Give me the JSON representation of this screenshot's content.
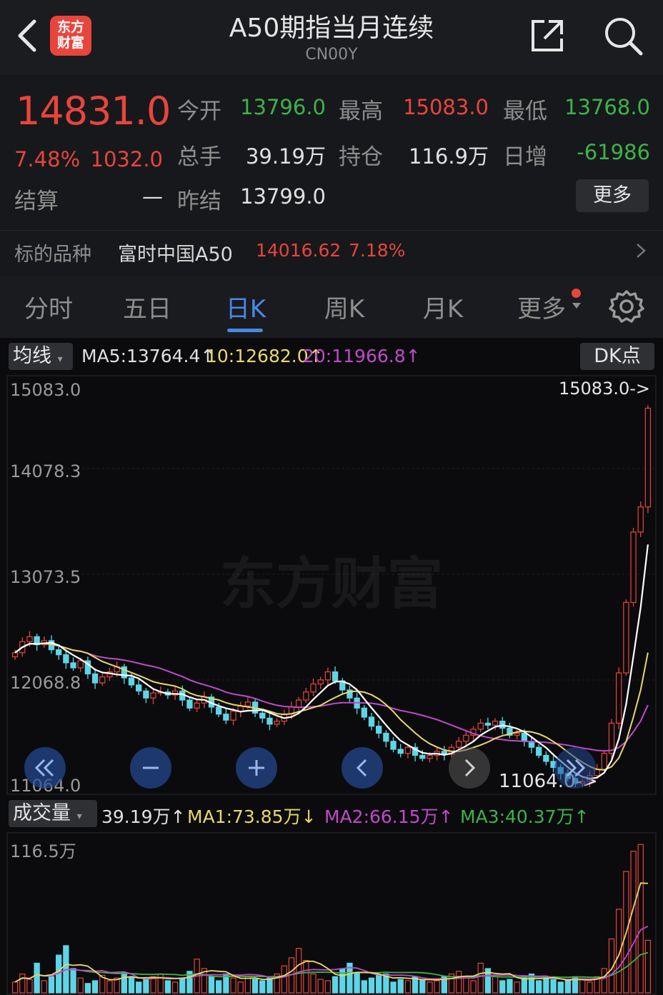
{
  "header": {
    "logo_line1": "东方",
    "logo_line2": "财富",
    "title": "A50期指当月连续",
    "code": "CN00Y"
  },
  "quote": {
    "price": "14831.0",
    "change_pct": "7.48%",
    "change_amt": "1032.0",
    "settle_label": "结算",
    "settle_value": "—",
    "open_label": "今开",
    "open_value": "13796.0",
    "high_label": "最高",
    "high_value": "15083.0",
    "low_label": "最低",
    "low_value": "13768.0",
    "volume_label": "总手",
    "volume_value": "39.19万",
    "oi_label": "持仓",
    "oi_value": "116.9万",
    "daily_inc_label": "日增",
    "daily_inc_value": "-61986",
    "prev_settle_label": "昨结",
    "prev_settle_value": "13799.0",
    "more_button": "更多",
    "underlying_label": "标的品种",
    "underlying_name": "富时中国A50",
    "underlying_price": "14016.62",
    "underlying_pct": "7.18%"
  },
  "tabs": [
    "分时",
    "五日",
    "日K",
    "周K",
    "月K",
    "更多"
  ],
  "active_tab": 2,
  "kline": {
    "ma_selector": "均线",
    "ma5": "MA5:13764.4",
    "ma10": "10:12682.0",
    "ma20": "20:11966.8",
    "dk_button": "DK点",
    "watermark": "东方财富",
    "y_labels": [
      "15083.0",
      "14078.3",
      "13073.5",
      "12068.8",
      "11064.0"
    ],
    "high_marker": "15083.0->",
    "low_marker": "11064.0->",
    "colors": {
      "up": "#e8453c",
      "down": "#5ed5e6",
      "ma5": "#ffffff",
      "ma10": "#e8d86a",
      "ma20": "#c04ac9",
      "ma3": "#3db34a"
    }
  },
  "volume": {
    "selector": "成交量",
    "vol": "39.19万",
    "ma1": "MA1:73.85万",
    "ma2": "MA2:66.15万",
    "ma3": "MA3:40.37万",
    "y_label": "116.5万"
  },
  "chart_data": {
    "type": "candlestick",
    "title": "",
    "ylim": [
      11064.0,
      15083.0
    ],
    "series": [
      {
        "values": [
          12400,
          12510,
          12560,
          12480,
          12520,
          12430,
          12380,
          12300,
          12250,
          12320,
          12190,
          12100,
          12160,
          12210,
          12260,
          12150,
          12080,
          12020,
          11950,
          12000,
          12010,
          11980,
          12020,
          11930,
          11850,
          11900,
          11960,
          11860,
          11790,
          11730,
          11820,
          11870,
          11910,
          11800,
          11750,
          11690,
          11720,
          11790,
          11860,
          11930,
          12010,
          12090,
          12130,
          12210,
          12120,
          12030,
          11950,
          11850,
          11760,
          11670,
          11600,
          11520,
          11440,
          11400,
          11460,
          11380,
          11350,
          11380,
          11420,
          11390,
          11460,
          11520,
          11580,
          11640,
          11700,
          11680,
          11720,
          11650,
          11580,
          11600,
          11520,
          11460,
          11380,
          11320,
          11260,
          11200,
          11150,
          11100,
          11120,
          11180,
          11240,
          11400,
          11700,
          12200,
          12900,
          13600,
          13850,
          14831
        ]
      }
    ],
    "volume_ylim": [
      0,
      116.5
    ],
    "volume_values": [
      8,
      14,
      10,
      22,
      9,
      12,
      28,
      35,
      18,
      11,
      7,
      9,
      13,
      9,
      11,
      15,
      12,
      8,
      10,
      12,
      14,
      9,
      8,
      11,
      16,
      25,
      18,
      12,
      9,
      14,
      11,
      8,
      12,
      10,
      9,
      11,
      14,
      20,
      26,
      33,
      24,
      14,
      10,
      9,
      12,
      18,
      22,
      15,
      9,
      11,
      13,
      14,
      8,
      10,
      9,
      12,
      10,
      8,
      9,
      12,
      14,
      16,
      11,
      9,
      22,
      18,
      12,
      9,
      10,
      8,
      12,
      14,
      9,
      11,
      10,
      8,
      9,
      12,
      10,
      8,
      12,
      18,
      40,
      62,
      90,
      105,
      110,
      39
    ]
  }
}
